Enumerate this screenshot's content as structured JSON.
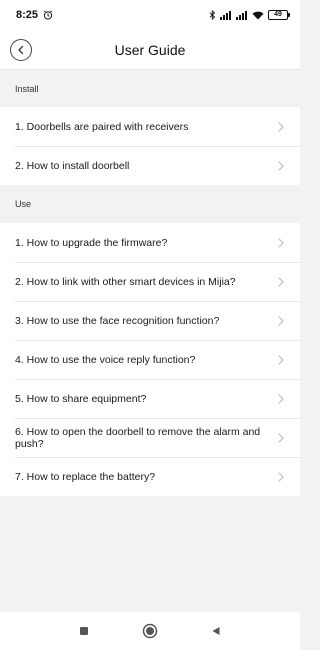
{
  "status_bar": {
    "time": "8:25",
    "battery": "49",
    "icons": [
      "alarm-icon",
      "bluetooth-icon",
      "signal-icon",
      "signal-icon",
      "wifi-icon",
      "battery-icon"
    ]
  },
  "header": {
    "title": "User Guide",
    "back_icon": "chevron-left-icon"
  },
  "sections": [
    {
      "title": "Install",
      "items": [
        "1. Doorbells are paired with receivers",
        "2. How to install doorbell"
      ]
    },
    {
      "title": "Use",
      "items": [
        "1. How to upgrade the firmware?",
        "2. How to link with other smart devices in Mijia?",
        "3. How to use the face recognition function?",
        "4. How to use the voice reply function?",
        "5. How to share equipment?",
        "6. How to open the doorbell to remove the alarm and push?",
        "7. How to replace the battery?"
      ]
    }
  ],
  "nav_bar": {
    "icons": [
      "recents-square-icon",
      "home-circle-icon",
      "back-triangle-icon"
    ]
  },
  "colors": {
    "background": "#f2f2f2",
    "surface": "#ffffff",
    "chevron": "#bbbbbb"
  }
}
